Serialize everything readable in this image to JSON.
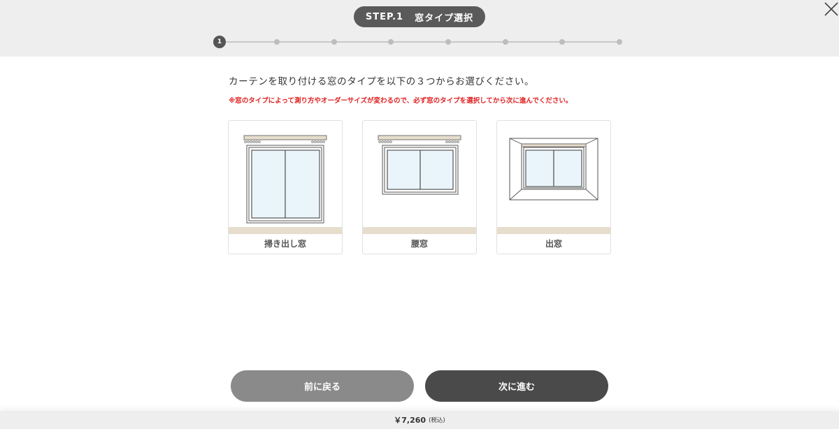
{
  "header": {
    "step_label": "STEP.1",
    "step_title": "窓タイプ選択",
    "close_icon": "close-icon"
  },
  "progress": {
    "current_step": "1",
    "total_steps": 8
  },
  "main": {
    "instruction": "カーテンを取り付ける窓のタイプを以下の３つからお選びください。",
    "warning": "※窓のタイプによって測り方やオーダーサイズが変わるので、必ず窓のタイプを選択してから次に進んでください。"
  },
  "window_types": [
    {
      "label": "掃き出し窓",
      "icon": "sliding-door-window-icon"
    },
    {
      "label": "腰窓",
      "icon": "waist-window-icon"
    },
    {
      "label": "出窓",
      "icon": "bay-window-icon"
    }
  ],
  "buttons": {
    "back_label": "前に戻る",
    "next_label": "次に進む"
  },
  "footer": {
    "price": "￥7,260",
    "tax_note": "(税込)"
  },
  "colors": {
    "pill": "#5a5a5a",
    "warning": "#e02020",
    "back_button": "#8a8a8a",
    "next_button": "#4a4a4a",
    "floor": "#e6ddcc",
    "glass": "#eaf5fb"
  }
}
